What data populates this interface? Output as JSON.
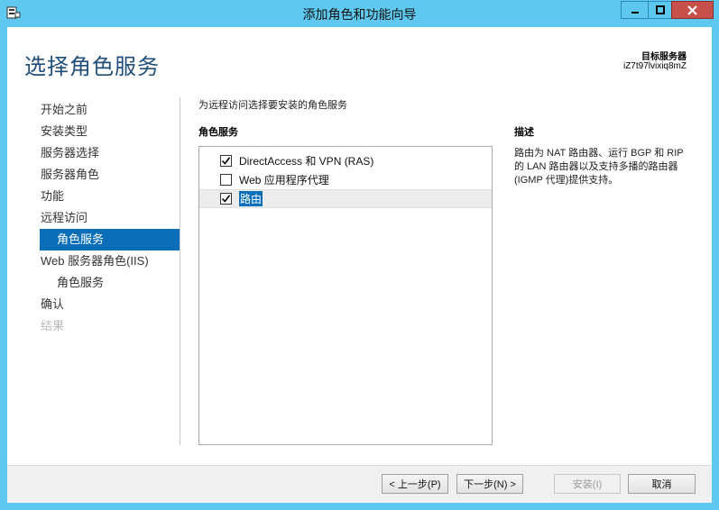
{
  "window": {
    "title": "添加角色和功能向导",
    "controls": {
      "minimize": "—",
      "maximize": "□",
      "close": "✕"
    }
  },
  "header": {
    "page_title": "选择角色服务",
    "target_label": "目标服务器",
    "target_value": "iZ7t97lvixiq8mZ"
  },
  "nav": {
    "items": [
      {
        "label": "开始之前",
        "state": "normal",
        "sub": false
      },
      {
        "label": "安装类型",
        "state": "normal",
        "sub": false
      },
      {
        "label": "服务器选择",
        "state": "normal",
        "sub": false
      },
      {
        "label": "服务器角色",
        "state": "normal",
        "sub": false
      },
      {
        "label": "功能",
        "state": "normal",
        "sub": false
      },
      {
        "label": "远程访问",
        "state": "normal",
        "sub": false
      },
      {
        "label": "角色服务",
        "state": "active",
        "sub": true
      },
      {
        "label": "Web 服务器角色(IIS)",
        "state": "normal",
        "sub": false
      },
      {
        "label": "角色服务",
        "state": "normal",
        "sub": true
      },
      {
        "label": "确认",
        "state": "normal",
        "sub": false
      },
      {
        "label": "结果",
        "state": "disabled",
        "sub": false
      }
    ]
  },
  "main": {
    "instruction": "为远程访问选择要安装的角色服务",
    "roles_heading": "角色服务",
    "roles": [
      {
        "label": "DirectAccess 和 VPN (RAS)",
        "checked": true,
        "selected": false
      },
      {
        "label": "Web 应用程序代理",
        "checked": false,
        "selected": false
      },
      {
        "label": "路由",
        "checked": true,
        "selected": true
      }
    ],
    "description_heading": "描述",
    "description": "路由为 NAT 路由器、运行 BGP 和 RIP 的 LAN 路由器以及支持多播的路由器(IGMP 代理)提供支持。"
  },
  "footer": {
    "prev_label": "< 上一步(P)",
    "next_label": "下一步(N) >",
    "install_label": "安装(I)",
    "cancel_label": "取消"
  },
  "colors": {
    "titlebar": "#5fc8ee",
    "accent": "#0a6fb8",
    "title_text": "#1f4e79"
  }
}
